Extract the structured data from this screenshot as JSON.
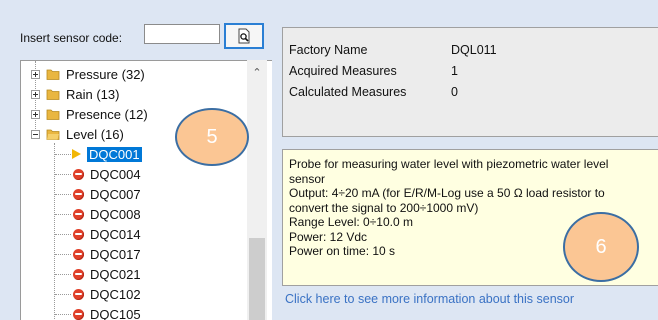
{
  "insert_sensor": {
    "label": "Insert sensor code:",
    "value": ""
  },
  "tree": {
    "items": [
      {
        "label": "Pressure (32)",
        "type": "folder",
        "state": "collapsed"
      },
      {
        "label": "Rain (13)",
        "type": "folder",
        "state": "collapsed"
      },
      {
        "label": "Presence (12)",
        "type": "folder",
        "state": "collapsed"
      },
      {
        "label": "Level (16)",
        "type": "folder",
        "state": "expanded"
      },
      {
        "label": "DQC001",
        "type": "sensor",
        "icon": "arrow-icon",
        "selected": true
      },
      {
        "label": "DQC004",
        "type": "sensor",
        "icon": "red-dot-icon"
      },
      {
        "label": "DQC007",
        "type": "sensor",
        "icon": "red-dot-icon"
      },
      {
        "label": "DQC008",
        "type": "sensor",
        "icon": "red-dot-icon"
      },
      {
        "label": "DQC014",
        "type": "sensor",
        "icon": "red-dot-icon"
      },
      {
        "label": "DQC017",
        "type": "sensor",
        "icon": "red-dot-icon"
      },
      {
        "label": "DQC021",
        "type": "sensor",
        "icon": "red-dot-icon"
      },
      {
        "label": "DQC102",
        "type": "sensor",
        "icon": "red-dot-icon"
      },
      {
        "label": "DQC105",
        "type": "sensor",
        "icon": "red-dot-icon"
      }
    ]
  },
  "info": {
    "rows": [
      {
        "key": "Factory Name",
        "value": "DQL011"
      },
      {
        "key": "Acquired Measures",
        "value": "1"
      },
      {
        "key": "Calculated Measures",
        "value": "0"
      }
    ]
  },
  "description": {
    "lines": [
      "Probe for measuring water level with piezometric water level",
      "sensor",
      "Output: 4÷20 mA (for E/R/M-Log use a 50 Ω load resistor to",
      "convert the signal to 200÷1000 mV)",
      "Range Level: 0÷10.0 m",
      "Power: 12 Vdc",
      "Power on time: 10 s"
    ]
  },
  "more_info_link": "Click here to see more information about this sensor",
  "callouts": {
    "first": "5",
    "second": "6"
  },
  "colors": {
    "background": "#dde6f3",
    "selection": "#0078d7",
    "description_bg": "#ffffe1",
    "callout_fill": "#fbc694",
    "callout_border": "#3b6ea3",
    "link": "#3a72c4",
    "sensor_dot": "#e0402a",
    "folder": "#e9b640"
  }
}
